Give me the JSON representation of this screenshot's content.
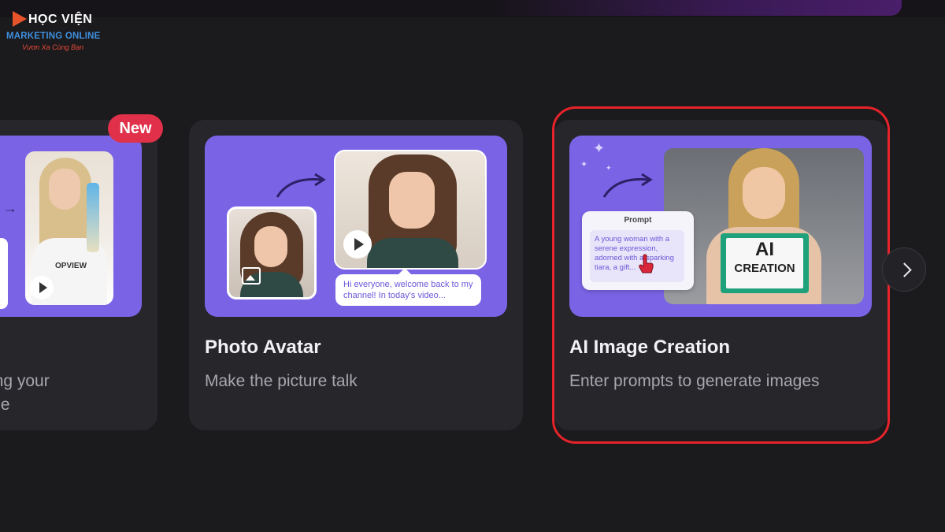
{
  "watermark": {
    "line1": "HỌC VIỆN",
    "line2": "MARKETING ONLINE",
    "line3": "Vươn Xa Cùng Bạn"
  },
  "cards": [
    {
      "badge": "New",
      "title": "",
      "desc_line1": "olding your",
      "desc_line2": "mage",
      "shirt_text": "OPVIEW"
    },
    {
      "title": "Photo Avatar",
      "desc": "Make the picture talk",
      "speech_text": "Hi everyone, welcome back to my channel! In today's video..."
    },
    {
      "title": "AI Image Creation",
      "desc": "Enter prompts to generate images",
      "prompt_label": "Prompt",
      "prompt_text": "A young woman with a serene expression, adorned with a sparking tiara, a gift...",
      "sign_line1": "AI",
      "sign_line2": "CREATION"
    }
  ],
  "carousel": {
    "next_icon": "chevron-right-icon"
  },
  "colors": {
    "background": "#1b1a1c",
    "card": "#27262b",
    "thumb_accent": "#7b63e6",
    "badge": "#e0304a",
    "highlight": "#e6232a"
  }
}
